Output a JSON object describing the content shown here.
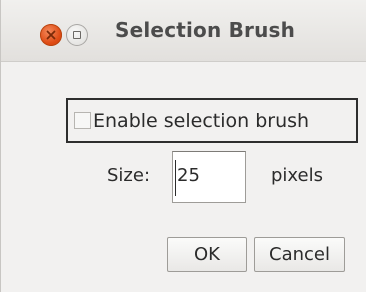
{
  "window": {
    "title": "Selection Brush",
    "accent_close": "#df4b14"
  },
  "options": {
    "enable_label": "Enable selection brush",
    "enable_checked": false
  },
  "size": {
    "label": "Size:",
    "value": "25",
    "units": "pixels"
  },
  "buttons": {
    "ok_label": "OK",
    "cancel_label": "Cancel"
  },
  "icons": {
    "close": "close-icon",
    "maximize": "maximize-icon"
  }
}
